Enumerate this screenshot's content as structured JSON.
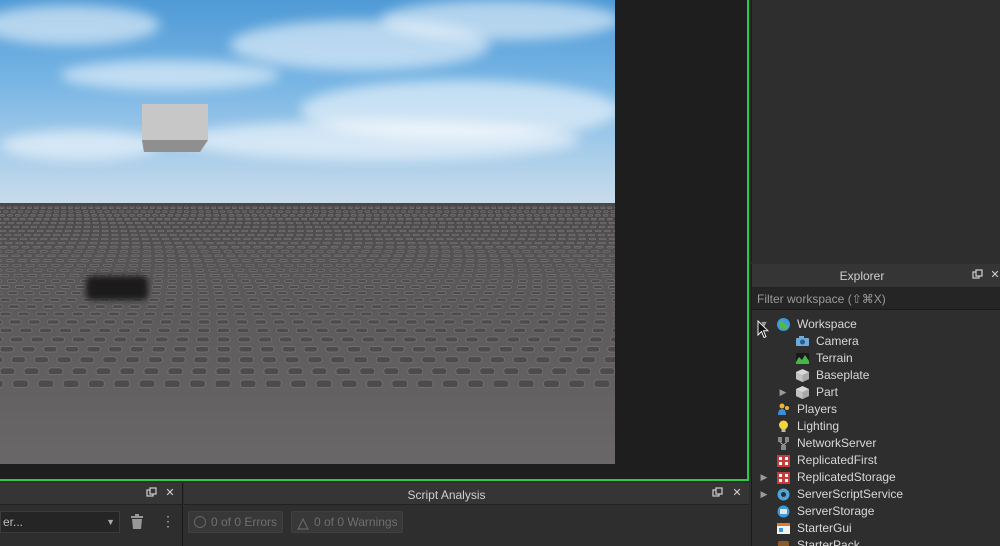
{
  "explorer": {
    "title": "Explorer",
    "filter_placeholder": "Filter workspace (⇧⌘X)",
    "items": [
      {
        "label": "Workspace",
        "icon": "workspace-globe-icon",
        "expanded": true,
        "depth": 0
      },
      {
        "label": "Camera",
        "icon": "camera-icon",
        "depth": 1
      },
      {
        "label": "Terrain",
        "icon": "terrain-icon",
        "depth": 1
      },
      {
        "label": "Baseplate",
        "icon": "part-cube-icon",
        "depth": 1
      },
      {
        "label": "Part",
        "icon": "part-cube-icon",
        "depth": 1,
        "collapsed": true
      },
      {
        "label": "Players",
        "icon": "players-icon",
        "depth": 0
      },
      {
        "label": "Lighting",
        "icon": "lighting-bulb-icon",
        "depth": 0
      },
      {
        "label": "NetworkServer",
        "icon": "network-server-icon",
        "depth": 0
      },
      {
        "label": "ReplicatedFirst",
        "icon": "replicated-first-icon",
        "depth": 0
      },
      {
        "label": "ReplicatedStorage",
        "icon": "replicated-storage-icon",
        "depth": 0,
        "collapsed": true
      },
      {
        "label": "ServerScriptService",
        "icon": "server-script-service-icon",
        "depth": 0,
        "collapsed": true
      },
      {
        "label": "ServerStorage",
        "icon": "server-storage-icon",
        "depth": 0
      },
      {
        "label": "StarterGui",
        "icon": "starter-gui-icon",
        "depth": 0
      },
      {
        "label": "StarterPack",
        "icon": "starter-pack-icon",
        "depth": 0
      }
    ]
  },
  "output_panel": {
    "filter_value": "er..."
  },
  "script_analysis": {
    "title": "Script Analysis",
    "errors_label": "0 of 0 Errors",
    "warnings_label": "0 of 0 Warnings"
  },
  "colors": {
    "viewport_border": "#2ec74b",
    "panel_bg": "#2e2e2e",
    "text": "#d8d8d8"
  }
}
